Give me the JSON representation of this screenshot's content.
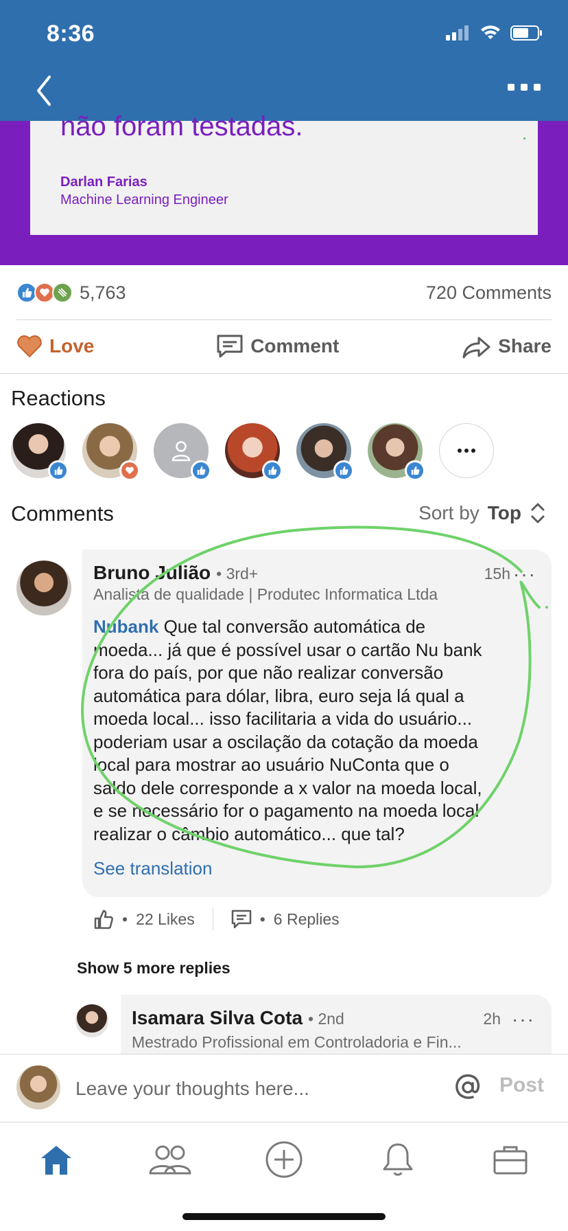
{
  "status_bar": {
    "time": "8:36"
  },
  "post": {
    "quote_text": "não foram testadas.",
    "author_name": "Darlan Farias",
    "author_role": "Machine Learning Engineer"
  },
  "social": {
    "reaction_count": "5,763",
    "comments_count": "720 Comments"
  },
  "actions": {
    "love": "Love",
    "comment": "Comment",
    "share": "Share"
  },
  "reactions_section": {
    "title": "Reactions"
  },
  "comments_section": {
    "title": "Comments",
    "sort_label": "Sort by",
    "sort_value": "Top"
  },
  "comment": {
    "author": "Bruno Julião",
    "degree": "• 3rd+",
    "time": "15h",
    "headline": "Analista de qualidade | Produtec Informatica Ltda",
    "mention": "Nubank",
    "lines": [
      " Que tal conversão automática de",
      "moeda... já que é possível usar o cartão Nu bank",
      "fora do país,  por que não realizar conversão",
      "automática para dólar, libra, euro seja lá qual a",
      "moeda local... isso facilitaria a vida do usuário...",
      "poderiam usar a oscilação da cotação da moeda",
      "local para mostrar ao usuário NuConta que o",
      "saldo dele corresponde a x valor na moeda local,",
      "e se necessário for o pagamento na moeda local",
      "realizar o câmbio automático... que tal?"
    ],
    "see_translation": "See translation",
    "likes": "22 Likes",
    "replies": "6 Replies",
    "dot": "•"
  },
  "show_more_replies": "Show 5 more replies",
  "reply": {
    "author": "Isamara Silva Cota",
    "degree": "• 2nd",
    "time": "2h",
    "headline": "Mestrado Profissional em Controladoria e Fin..."
  },
  "composer": {
    "placeholder": "Leave your thoughts here...",
    "post_label": "Post"
  },
  "more_label": "···",
  "colors": {
    "brand_blue": "#2f6fae",
    "post_purple": "#7a1fbe",
    "love_orange": "#c4622d",
    "annotation_green": "#6fd26a"
  },
  "icons": [
    "back-icon",
    "more-icon",
    "like-icon",
    "love-icon",
    "celebrate-icon",
    "heart-icon",
    "comment-icon",
    "share-icon",
    "sort-icon",
    "at-icon",
    "home-icon",
    "network-icon",
    "add-post-icon",
    "notifications-icon",
    "jobs-icon"
  ]
}
